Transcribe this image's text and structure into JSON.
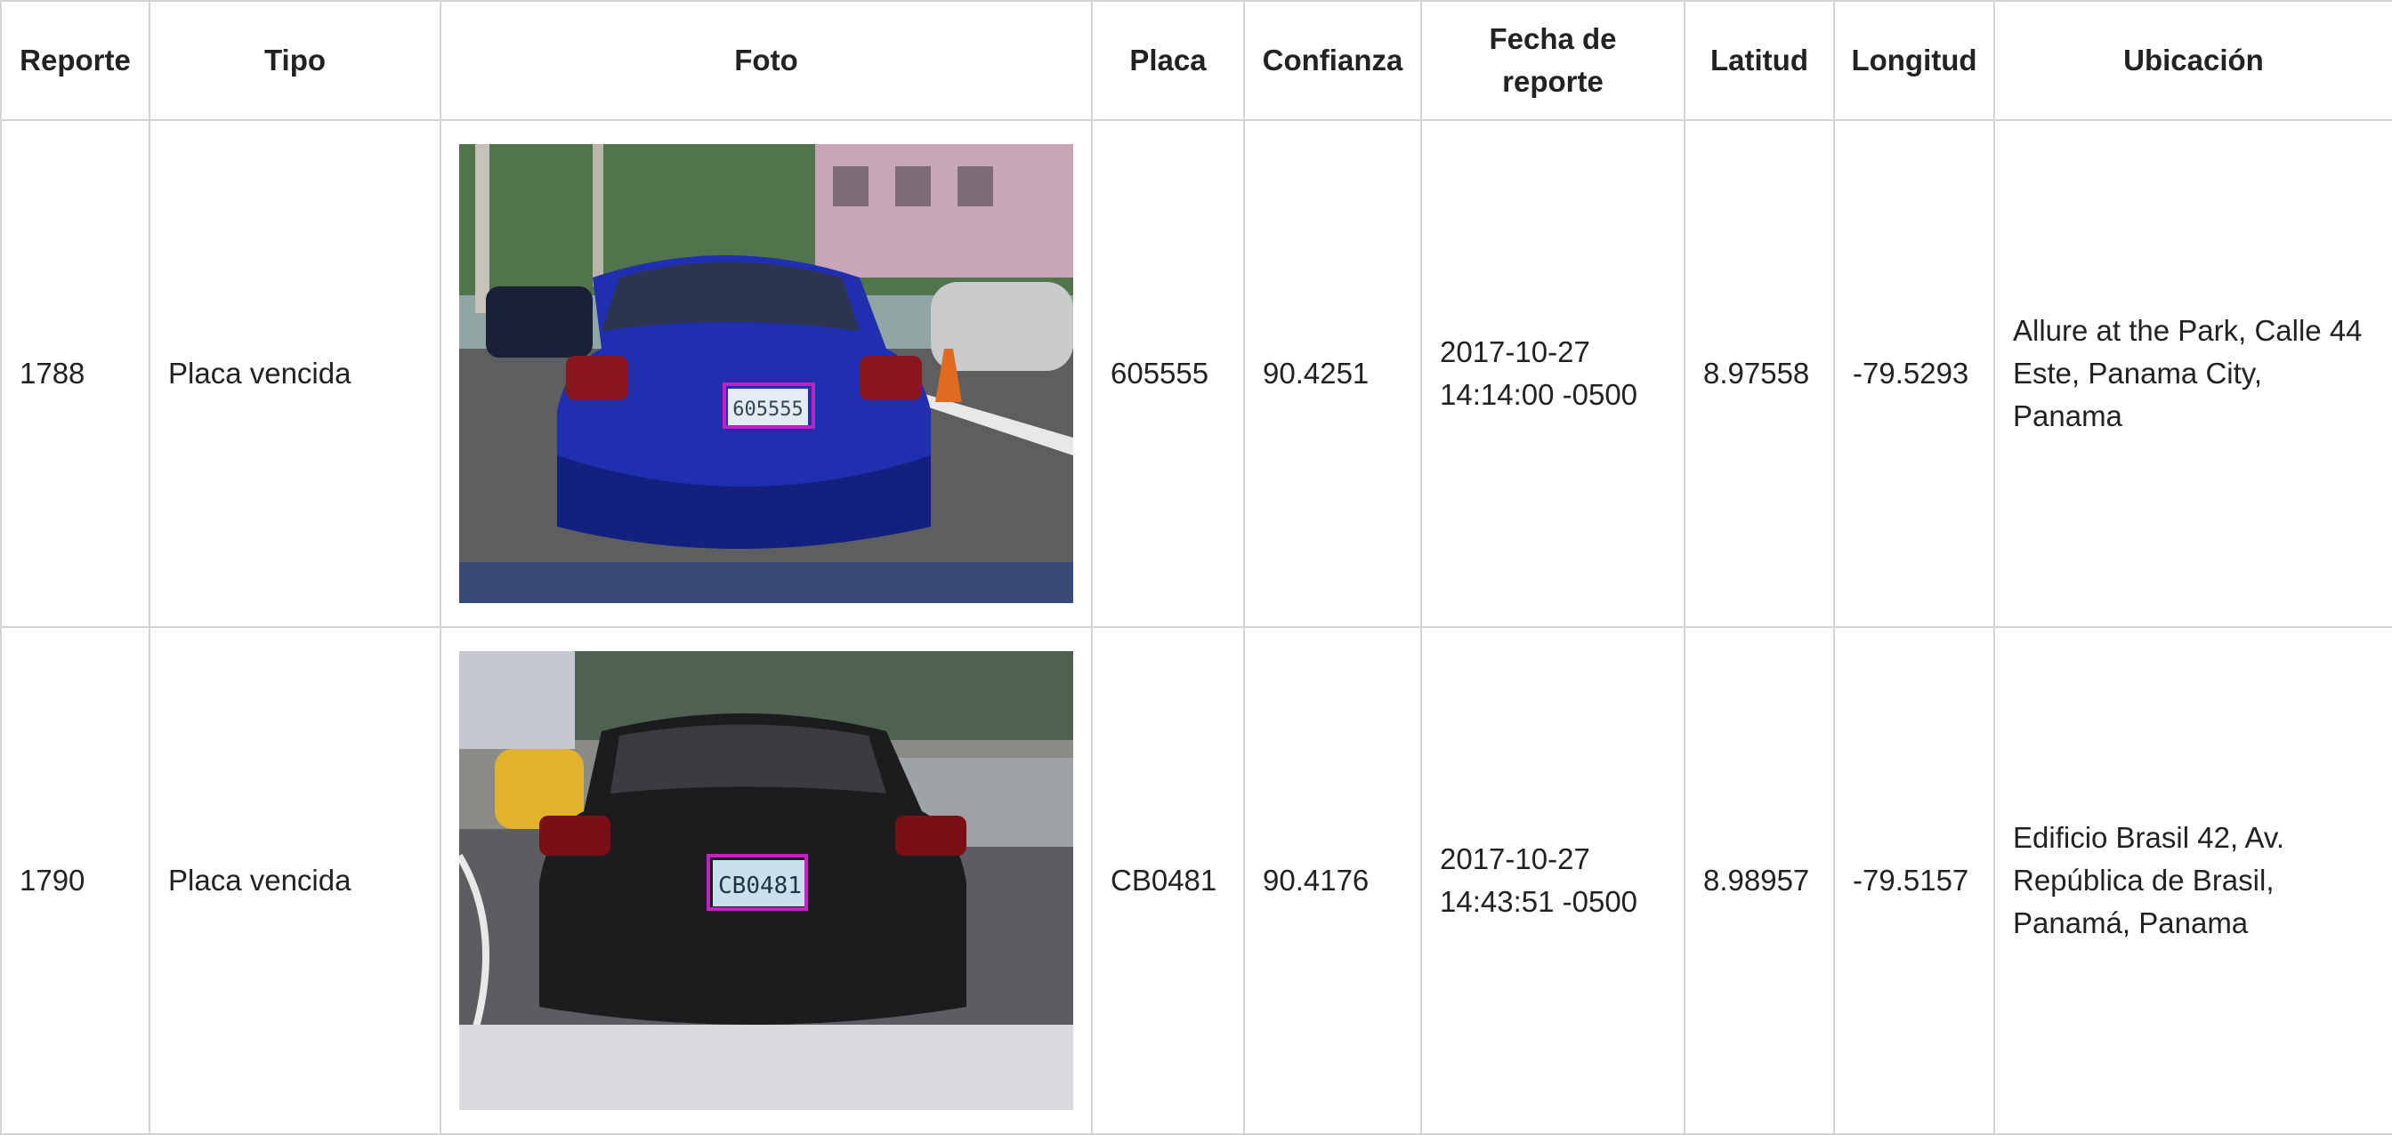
{
  "headers": {
    "reporte": "Reporte",
    "tipo": "Tipo",
    "foto": "Foto",
    "placa": "Placa",
    "confianza": "Confianza",
    "fecha_line1": "Fecha de",
    "fecha_line2": "reporte",
    "latitud": "Latitud",
    "longitud": "Longitud",
    "ubicacion": "Ubicación"
  },
  "rows": [
    {
      "reporte": "1788",
      "tipo": "Placa vencida",
      "photo": {
        "car_color": "#1f2fb0",
        "scene": "parking street",
        "plate_text": "605555"
      },
      "placa": "605555",
      "confianza": "90.4251",
      "fecha_line1": "2017-10-27",
      "fecha_line2": "14:14:00 -0500",
      "latitud": "8.97558",
      "longitud": "-79.5293",
      "ubicacion_line1": "Allure at the Park, Calle 44",
      "ubicacion_line2": "Este, Panama City, Panama",
      "ubicacion_line3": ""
    },
    {
      "reporte": "1790",
      "tipo": "Placa vencida",
      "photo": {
        "car_color": "#1c1c1e",
        "scene": "road with taxi",
        "plate_text": "CB0481"
      },
      "placa": "CB0481",
      "confianza": "90.4176",
      "fecha_line1": "2017-10-27",
      "fecha_line2": "14:43:51 -0500",
      "latitud": "8.98957",
      "longitud": "-79.5157",
      "ubicacion_line1": "Edificio Brasil 42, Av.",
      "ubicacion_line2": "República de Brasil,",
      "ubicacion_line3": "Panamá, Panama"
    }
  ]
}
